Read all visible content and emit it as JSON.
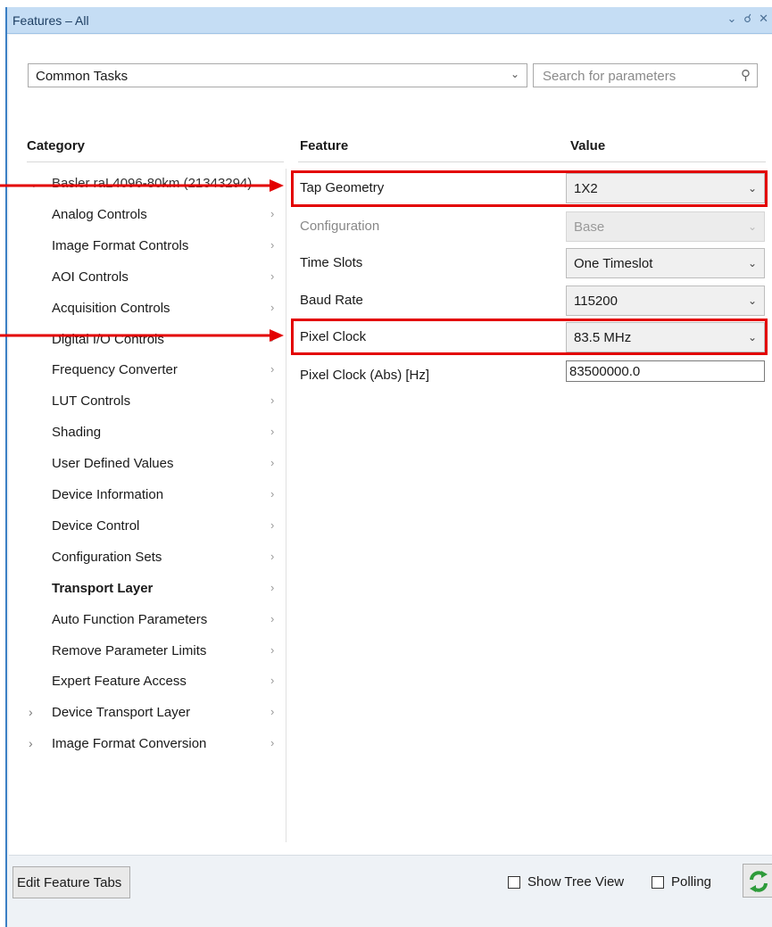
{
  "window": {
    "title": "Features – All"
  },
  "toolbar": {
    "preset": "Common Tasks",
    "search_placeholder": "Search for parameters"
  },
  "columns": {
    "category": "Category",
    "feature": "Feature",
    "value": "Value"
  },
  "categories": [
    {
      "label": "Basler raL4096-80km (21343294)",
      "expander": "collapse"
    },
    {
      "label": "Analog Controls"
    },
    {
      "label": "Image Format Controls"
    },
    {
      "label": "AOI Controls"
    },
    {
      "label": "Acquisition Controls"
    },
    {
      "label": "Digital I/O Controls"
    },
    {
      "label": "Frequency Converter"
    },
    {
      "label": "LUT Controls"
    },
    {
      "label": "Shading"
    },
    {
      "label": "User Defined Values"
    },
    {
      "label": "Device Information"
    },
    {
      "label": "Device Control"
    },
    {
      "label": "Configuration Sets"
    },
    {
      "label": "Transport Layer",
      "selected": true
    },
    {
      "label": "Auto Function Parameters"
    },
    {
      "label": "Remove Parameter Limits"
    },
    {
      "label": "Expert Feature Access"
    },
    {
      "label": "Device Transport Layer",
      "expander": "expand"
    },
    {
      "label": "Image Format Conversion",
      "expander": "expand"
    }
  ],
  "features": [
    {
      "name": "Tap Geometry",
      "value": "1X2",
      "control": "dropdown",
      "highlighted": true
    },
    {
      "name": "Configuration",
      "value": "Base",
      "control": "dropdown",
      "enabled": false
    },
    {
      "name": "Time Slots",
      "value": "One Timeslot",
      "control": "dropdown"
    },
    {
      "name": "Baud Rate",
      "value": "115200",
      "control": "dropdown"
    },
    {
      "name": "Pixel Clock",
      "value": "83.5 MHz",
      "control": "dropdown",
      "highlighted": true
    },
    {
      "name": "Pixel Clock (Abs) [Hz]",
      "value": "83500000.0",
      "control": "text"
    }
  ],
  "bottom": {
    "edit_tabs": "Edit Feature Tabs",
    "show_tree_view": "Show Tree View",
    "show_tree_view_checked": false,
    "polling": "Polling",
    "polling_checked": false
  },
  "colors": {
    "title_bar": "#c5ddf4",
    "highlight_annotation": "#e30000",
    "refresh_icon": "#2e9b3a"
  }
}
